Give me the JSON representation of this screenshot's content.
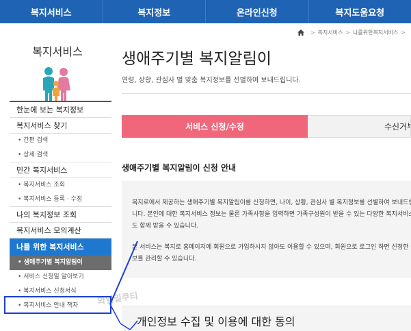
{
  "topnav": {
    "items": [
      "복지서비스",
      "복지정보",
      "온라인신청",
      "복지도움요청"
    ]
  },
  "breadcrumb": {
    "items": [
      "복지서비스",
      "나를위한복지서비스",
      ""
    ]
  },
  "sidebar": {
    "title": "복지서비스",
    "menu": [
      {
        "label": "한눈에 보는 복지정보"
      },
      {
        "label": "복지서비스 찾기"
      },
      {
        "label": "• 간편 검색"
      },
      {
        "label": "• 상세 검색"
      },
      {
        "label": "민간 복지서비스"
      },
      {
        "label": "• 복지서비스 조회"
      },
      {
        "label": "• 복지서비스 등록 · 수정"
      },
      {
        "label": "나의 복지정보 조회"
      },
      {
        "label": "복지서비스 모의계산"
      },
      {
        "label": "나를 위한 복지서비스"
      },
      {
        "label": "• 생애주기별 복지알림이"
      },
      {
        "label": "• 서비스 신청일 알아보기"
      },
      {
        "label": "• 복지서비스 신청서식"
      },
      {
        "label": "• 복지서비스 안내 책자"
      }
    ]
  },
  "main": {
    "title": "생애주기별 복지알림이",
    "subtitle": "연령, 상황, 관심사 별 맞춤 복지정보를 선별하여 보내드립니다.",
    "tabs": [
      {
        "label": "서비스 신청/수정"
      },
      {
        "label": "수신거부"
      }
    ],
    "section_title": "생애주기별 복지알림이 신청 안내",
    "info_p1": "복지로에서 제공하는 생애주기별 복지알림이를 신청하면, 나이, 상황, 관심사 별 복지정보를 선별하여 보내드립니다. 본인에 대한 복지서비스 정보는 물론 가족사항을 입력하면 가족구성원이 받을 수 있는 다양한 복지서비스도 함께 받을 수 있습니다.",
    "info_p2": "본 서비스는 복지로 홈페이지에 회원으로 가입하시지 않아도 이용할 수 있으며, 회원으로 로그인 하면 신청한 정보를 관리할 수 있습니다.",
    "consent_title": "개인정보 수집 및 이용에 대한 동의"
  },
  "watermark": "와일밀쿠티",
  "colors": {
    "nav_bg": "#1f63b4",
    "active_menu": "#1f78cf",
    "selected_submenu": "#6d6d6d",
    "active_tab": "#f0677b",
    "annotation": "#1a3fd6"
  }
}
